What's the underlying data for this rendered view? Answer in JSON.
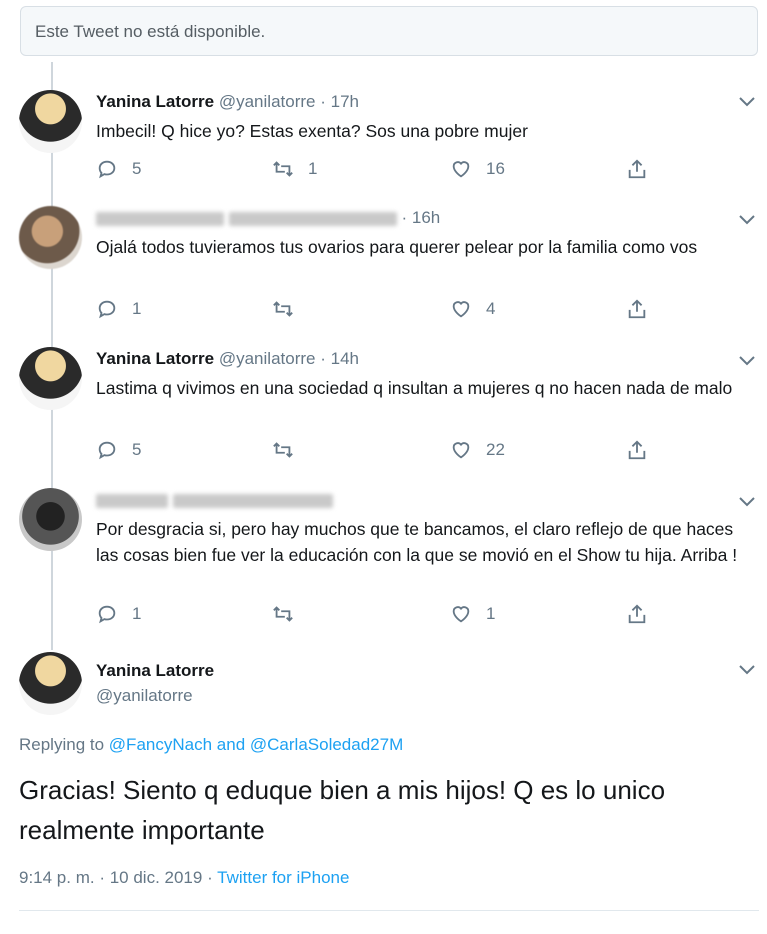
{
  "unavailable_notice": "Este Tweet no está disponible.",
  "tweets": [
    {
      "name": "Yanina Latorre",
      "handle": "@yanilatorre",
      "separator": "·",
      "time": "17h",
      "text": "Imbecil! Q hice yo? Estas exenta? Sos una pobre mujer",
      "replies": "5",
      "retweets": "1",
      "likes": "16"
    },
    {
      "name": "",
      "handle": "",
      "separator": "·",
      "time": "16h",
      "text": "Ojalá todos tuvieramos tus ovarios para querer pelear por la familia como vos",
      "replies": "1",
      "retweets": "",
      "likes": "4"
    },
    {
      "name": "Yanina Latorre",
      "handle": "@yanilatorre",
      "separator": "·",
      "time": "14h",
      "text": "Lastima q vivimos en una sociedad q insultan a mujeres q no hacen nada de malo",
      "replies": "5",
      "retweets": "",
      "likes": "22"
    },
    {
      "name": "",
      "handle": "",
      "separator": "",
      "time": "",
      "text": "Por desgracia si, pero hay muchos que te bancamos, el claro reflejo de que haces las cosas bien fue ver la educación con la que se movió en el Show tu hija. Arriba !",
      "replies": "1",
      "retweets": "",
      "likes": "1"
    }
  ],
  "main_tweet": {
    "name": "Yanina Latorre",
    "handle": "@yanilatorre",
    "replying_prefix": "Replying to",
    "reply_user_1": "@FancyNach",
    "reply_and": "and",
    "reply_user_2": "@CarlaSoledad27M",
    "text": "Gracias! Siento q eduque bien a mis hijos! Q es lo unico realmente importante",
    "timestamp": "9:14 p. m. · 10 dic. 2019",
    "meta_separator": "·",
    "source": "Twitter for iPhone"
  },
  "icons": [
    "reply-icon",
    "retweet-icon",
    "like-icon",
    "share-icon",
    "chevron-down-icon"
  ],
  "colors": {
    "link": "#1da1f2",
    "muted": "#657786",
    "text": "#14171a",
    "thread_line": "#cfd6dc"
  }
}
